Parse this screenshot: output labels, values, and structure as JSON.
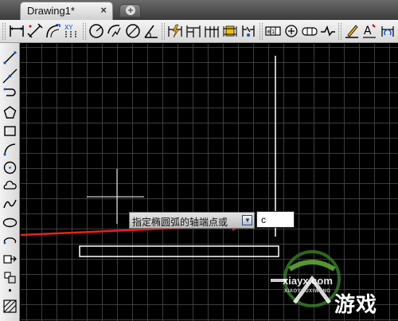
{
  "tabs": {
    "active_label": "Drawing1*",
    "close_glyph": "×",
    "new_tab_glyph": "+"
  },
  "toolbar_top": {
    "groups": [
      [
        "linear-dim-icon",
        "aligned-dim-icon",
        "arc-length-dim-icon",
        "ordinate-dim-icon"
      ],
      [
        "radius-dim-icon",
        "jogged-dim-icon",
        "diameter-dim-icon",
        "angular-dim-icon"
      ],
      [
        "quick-dim-icon",
        "baseline-dim-icon",
        "continue-dim-icon",
        "dim-space-icon",
        "dim-break-icon"
      ],
      [
        "tolerance-icon",
        "center-mark-icon",
        "inspection-icon",
        "jogged-linear-icon"
      ],
      [
        "dim-edit-icon",
        "dim-text-edit-icon",
        "dim-update-icon"
      ]
    ]
  },
  "toolbar_left": {
    "items": [
      "line-icon",
      "construction-line-icon",
      "polyline-icon",
      "polygon-icon",
      "rectangle-icon",
      "arc-icon",
      "circle-icon",
      "revision-cloud-icon",
      "spline-icon",
      "ellipse-icon",
      "ellipse-arc-icon",
      "insert-block-icon",
      "make-block-icon",
      "point-icon",
      "hatch-icon"
    ]
  },
  "command_prompt": {
    "text": "指定椭圆弧的轴端点或",
    "dropdown_glyph": "▼",
    "input_value": "c"
  },
  "watermark": {
    "domain": "xiayx.com",
    "subtitle": "XIAOYOUXIWANG",
    "brand": "游戏"
  },
  "colors": {
    "canvas_bg": "#000000",
    "grid": "#464646",
    "annotation_arrow": "#e8231a",
    "watermark_green": "#3a8a2a"
  }
}
